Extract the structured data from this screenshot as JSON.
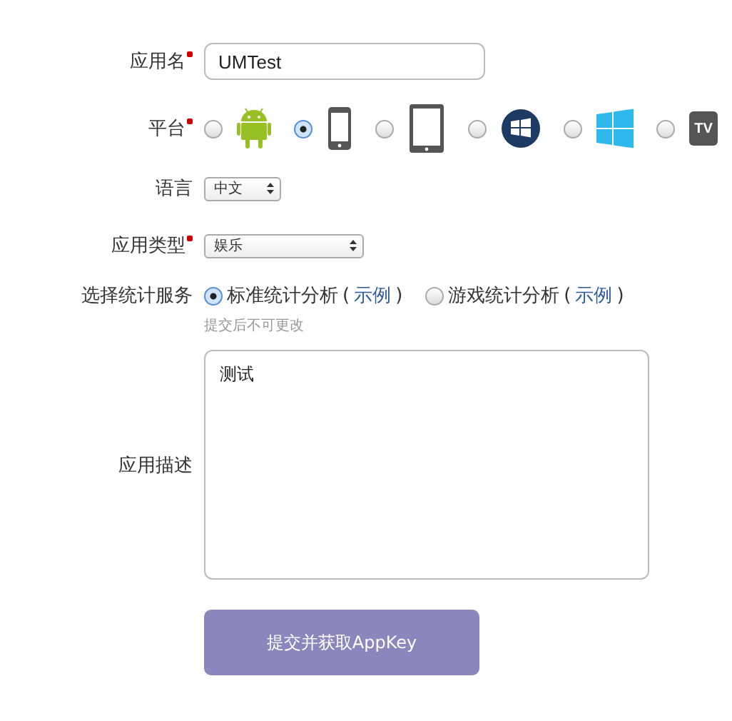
{
  "app_name": {
    "label": "应用名",
    "required": true,
    "value": "UMTest"
  },
  "platform": {
    "label": "平台",
    "required": true,
    "options": [
      {
        "kind": "android",
        "selected": false
      },
      {
        "kind": "phone",
        "selected": true
      },
      {
        "kind": "tablet",
        "selected": false
      },
      {
        "kind": "windows-phone",
        "selected": false
      },
      {
        "kind": "windows",
        "selected": false
      },
      {
        "kind": "tv",
        "selected": false,
        "icon_text": "TV"
      }
    ]
  },
  "language": {
    "label": "语言",
    "value": "中文"
  },
  "app_type": {
    "label": "应用类型",
    "required": true,
    "value": "娱乐"
  },
  "service": {
    "label": "选择统计服务",
    "options": [
      {
        "label": "标准统计分析",
        "open": "(",
        "link": "示例",
        "close": ")",
        "selected": true
      },
      {
        "label": "游戏统计分析",
        "open": "(",
        "link": "示例",
        "close": ")",
        "selected": false
      }
    ],
    "note": "提交后不可更改"
  },
  "description": {
    "label": "应用描述",
    "value": "测试"
  },
  "submit": "提交并获取AppKey"
}
